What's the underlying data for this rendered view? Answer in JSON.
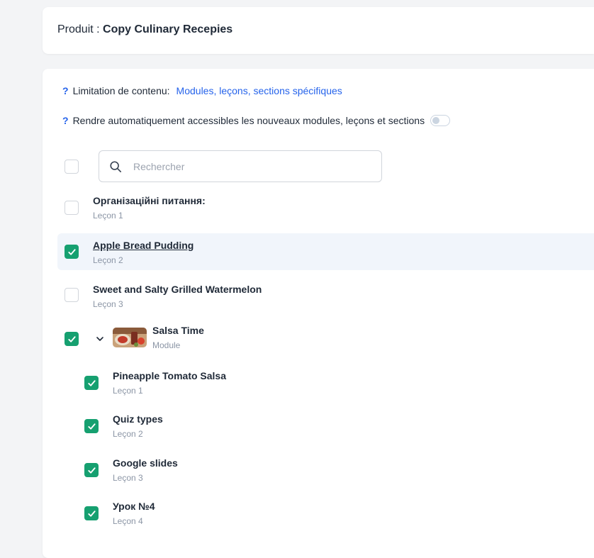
{
  "product": {
    "prefix": "Produit : ",
    "name": "Copy Culinary Recepies"
  },
  "settings": {
    "limitation": {
      "help": "?",
      "label": "Limitation de contenu:",
      "link": "Modules, leçons, sections spécifiques"
    },
    "auto_access": {
      "help": "?",
      "label": "Rendre automatiquement accessibles les nouveaux modules, leçons et sections",
      "enabled": false
    }
  },
  "search": {
    "placeholder": "Rechercher",
    "value": ""
  },
  "items": [
    {
      "title": "Організаційні питання:",
      "sub": "Leçon 1",
      "checked": false
    },
    {
      "title": "Apple Bread Pudding",
      "sub": "Leçon 2",
      "checked": true
    },
    {
      "title": "Sweet and Salty Grilled Watermelon",
      "sub": "Leçon 3",
      "checked": false
    },
    {
      "title": "Salsa Time",
      "sub": "Module",
      "checked": true,
      "expanded": true
    }
  ],
  "children": [
    {
      "title": "Pineapple Tomato Salsa",
      "sub": "Leçon 1",
      "checked": true
    },
    {
      "title": "Quiz types",
      "sub": "Leçon 2",
      "checked": true
    },
    {
      "title": "Google slides",
      "sub": "Leçon 3",
      "checked": true
    },
    {
      "title": "Урок №4",
      "sub": "Leçon 4",
      "checked": true
    }
  ],
  "colors": {
    "accent": "#16a070",
    "link": "#2563eb",
    "highlight": "#f1f5fb"
  }
}
